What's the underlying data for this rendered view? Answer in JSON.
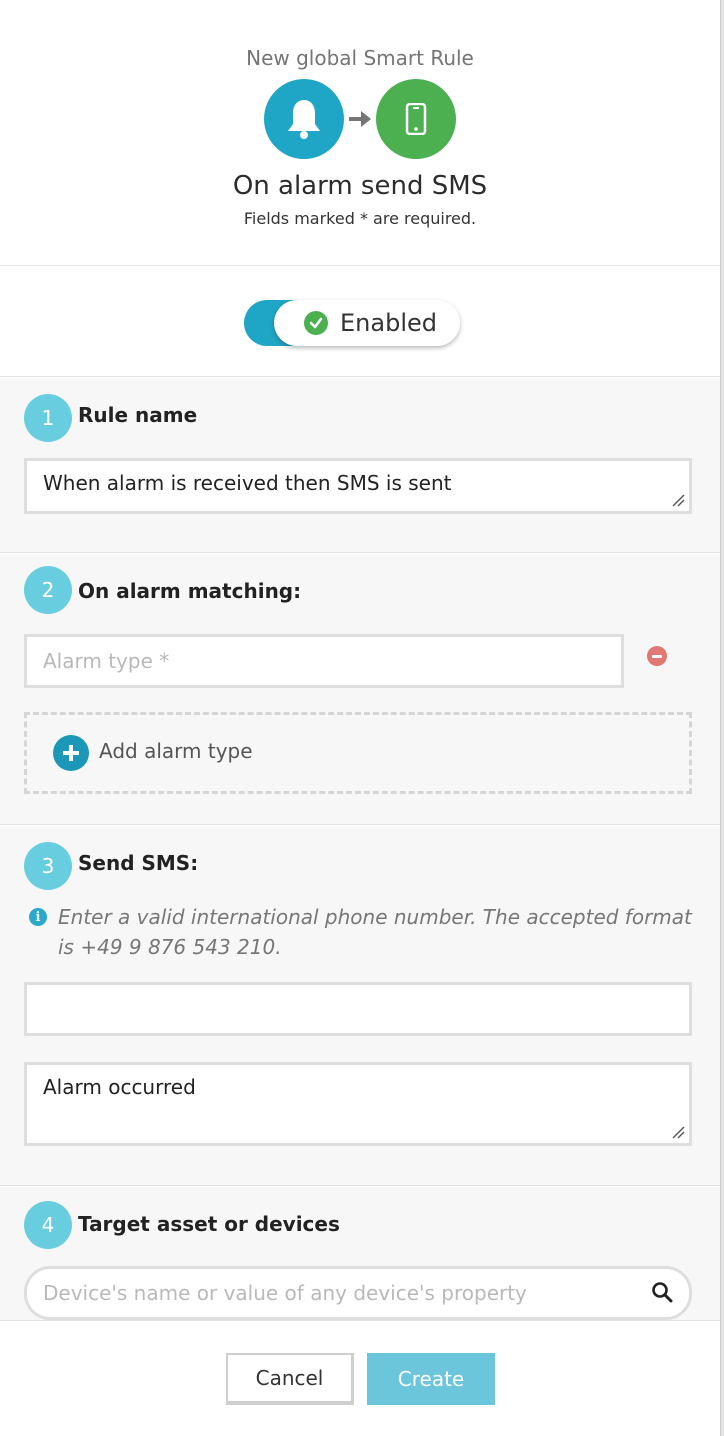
{
  "header": {
    "subtitle": "New global Smart Rule",
    "title": "On alarm send SMS",
    "required_note": "Fields marked * are required.",
    "icons": [
      "bell-icon",
      "arrow-right-icon",
      "mobile-phone-icon"
    ],
    "colors": {
      "bell": "#1fa6c7",
      "phone": "#4caf50"
    }
  },
  "toggle": {
    "label": "Enabled",
    "state": "on",
    "color": "#1fa6c7"
  },
  "steps": [
    {
      "number": "1",
      "title": "Rule name",
      "field_value": "When alarm is received then SMS is sent"
    },
    {
      "number": "2",
      "title": "On alarm matching:",
      "alarm_type_placeholder": "Alarm type *",
      "add_label": "Add alarm type"
    },
    {
      "number": "3",
      "title": "Send SMS:",
      "hint": "Enter a valid international phone number. The accepted format is +49 9 876 543 210.",
      "phone_value": "",
      "message_value": "Alarm occurred"
    },
    {
      "number": "4",
      "title": "Target asset or devices",
      "search_placeholder": "Device's name or value of any device's property"
    }
  ],
  "footer": {
    "cancel_label": "Cancel",
    "create_label": "Create"
  },
  "accent": "#69cde0"
}
